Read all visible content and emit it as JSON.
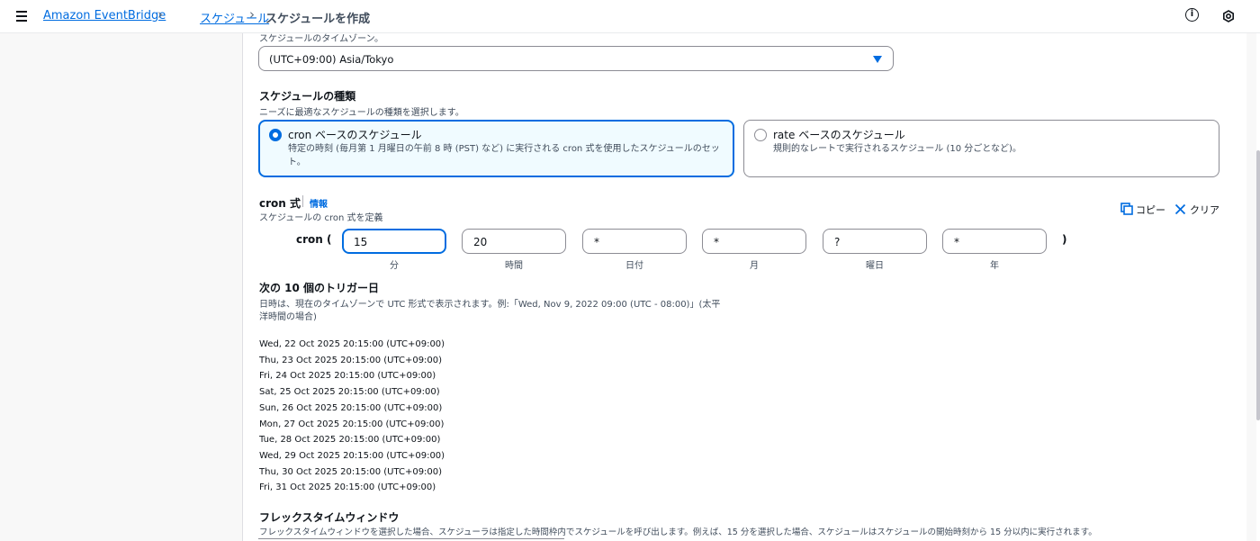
{
  "breadcrumbs": [
    "Amazon EventBridge",
    "スケジュール"
  ],
  "page_title": "スケジュールを作成",
  "timezone": {
    "label": "スケジュールのタイムゾーン。",
    "value": "(UTC+09:00) Asia/Tokyo"
  },
  "schedule_type": {
    "heading": "スケジュールの種類",
    "description": "ニーズに最適なスケジュールの種類を選択します。",
    "options": [
      {
        "title": "cron ベースのスケジュール",
        "description": "特定の時刻 (毎月第 1 月曜日の午前 8 時 (PST) など) に実行される cron 式を使用したスケジュールのセット。",
        "selected": true
      },
      {
        "title": "rate ベースのスケジュール",
        "description": "規則的なレートで実行されるスケジュール (10 分ごとなど)。",
        "selected": false
      }
    ]
  },
  "cron": {
    "heading": "cron 式",
    "info_link": "情報",
    "description": "スケジュールの cron 式を定義",
    "copy_label": "コピー",
    "clear_label": "クリア",
    "prefix": "cron (",
    "suffix": ")",
    "fields": [
      {
        "label": "分",
        "value": "15"
      },
      {
        "label": "時間",
        "value": "20"
      },
      {
        "label": "日付",
        "value": "*"
      },
      {
        "label": "月",
        "value": "*"
      },
      {
        "label": "曜日",
        "value": "?"
      },
      {
        "label": "年",
        "value": "*"
      }
    ]
  },
  "triggers": {
    "heading": "次の 10 個のトリガー日",
    "description_line1": "日時は、現在のタイムゾーンで UTC 形式で表示されます。例:「Wed, Nov 9, 2022 09:00 (UTC - 08:00)」(太平",
    "description_line2": "洋時間の場合)",
    "dates": [
      "Wed, 22 Oct 2025 20:15:00 (UTC+09:00)",
      "Thu, 23 Oct 2025 20:15:00 (UTC+09:00)",
      "Fri, 24 Oct 2025 20:15:00 (UTC+09:00)",
      "Sat, 25 Oct 2025 20:15:00 (UTC+09:00)",
      "Sun, 26 Oct 2025 20:15:00 (UTC+09:00)",
      "Mon, 27 Oct 2025 20:15:00 (UTC+09:00)",
      "Tue, 28 Oct 2025 20:15:00 (UTC+09:00)",
      "Wed, 29 Oct 2025 20:15:00 (UTC+09:00)",
      "Thu, 30 Oct 2025 20:15:00 (UTC+09:00)",
      "Fri, 31 Oct 2025 20:15:00 (UTC+09:00)"
    ]
  },
  "flex_window": {
    "heading": "フレックスタイムウィンドウ",
    "description": "フレックスタイムウィンドウを選択した場合、スケジューラは指定した時間枠内でスケジュールを呼び出します。例えば、15 分を選択した場合、スケジュールはスケジュールの開始時刻から 15 分以内に実行されます。"
  },
  "colors": {
    "accent": "#006ce0",
    "selected_bg": "#f0fbff",
    "text": "#0f141a",
    "muted": "#414d5c"
  },
  "icons": [
    "menu-icon",
    "chevron-right-icon",
    "info-icon",
    "settings-icon",
    "copy-icon",
    "close-icon",
    "caret-down-icon"
  ]
}
